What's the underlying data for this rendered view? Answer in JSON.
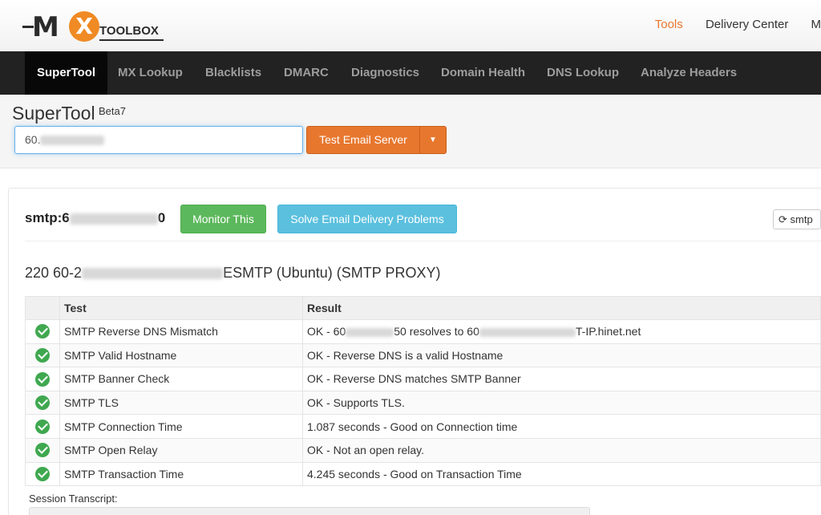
{
  "brand": {
    "logo_text": "MX",
    "logo_word": "TOOLBOX"
  },
  "toplinks": [
    {
      "label": "Tools",
      "active": true
    },
    {
      "label": "Delivery Center",
      "active": false
    },
    {
      "label": "M",
      "active": false
    }
  ],
  "nav": [
    {
      "label": "SuperTool",
      "active": true
    },
    {
      "label": "MX Lookup"
    },
    {
      "label": "Blacklists"
    },
    {
      "label": "DMARC"
    },
    {
      "label": "Diagnostics"
    },
    {
      "label": "Domain Health"
    },
    {
      "label": "DNS Lookup"
    },
    {
      "label": "Analyze Headers"
    }
  ],
  "supertool": {
    "title": "SuperTool",
    "beta": "Beta7",
    "input_value": "60.",
    "test_button": "Test Email Server"
  },
  "result": {
    "command": "smtp:6",
    "command_suffix": "0",
    "monitor_button": "Monitor This",
    "solve_button": "Solve Email Delivery Problems",
    "refresh_button": "smtp",
    "banner_prefix": "220 60-2",
    "banner_suffix": "ESMTP (Ubuntu) (SMTP PROXY)",
    "headers": {
      "test": "Test",
      "result": "Result"
    },
    "rows": [
      {
        "test": "SMTP Reverse DNS Mismatch",
        "result": "OK - 60",
        "result_mid": "50 resolves to 60",
        "result_end": "T-IP.hinet.net"
      },
      {
        "test": "SMTP Valid Hostname",
        "result": "OK - Reverse DNS is a valid Hostname"
      },
      {
        "test": "SMTP Banner Check",
        "result": "OK - Reverse DNS matches SMTP Banner"
      },
      {
        "test": "SMTP TLS",
        "result": "OK - Supports TLS."
      },
      {
        "test": "SMTP Connection Time",
        "result": "1.087 seconds - Good on Connection time"
      },
      {
        "test": "SMTP Open Relay",
        "result": "OK - Not an open relay."
      },
      {
        "test": "SMTP Transaction Time",
        "result": "4.245 seconds - Good on Transaction Time"
      }
    ],
    "transcript_label": "Session Transcript:"
  },
  "colors": {
    "accent": "#e8772e",
    "nav_bg": "#222222",
    "success": "#5cb85c",
    "info": "#5bc0de",
    "check": "#3fa84f"
  }
}
